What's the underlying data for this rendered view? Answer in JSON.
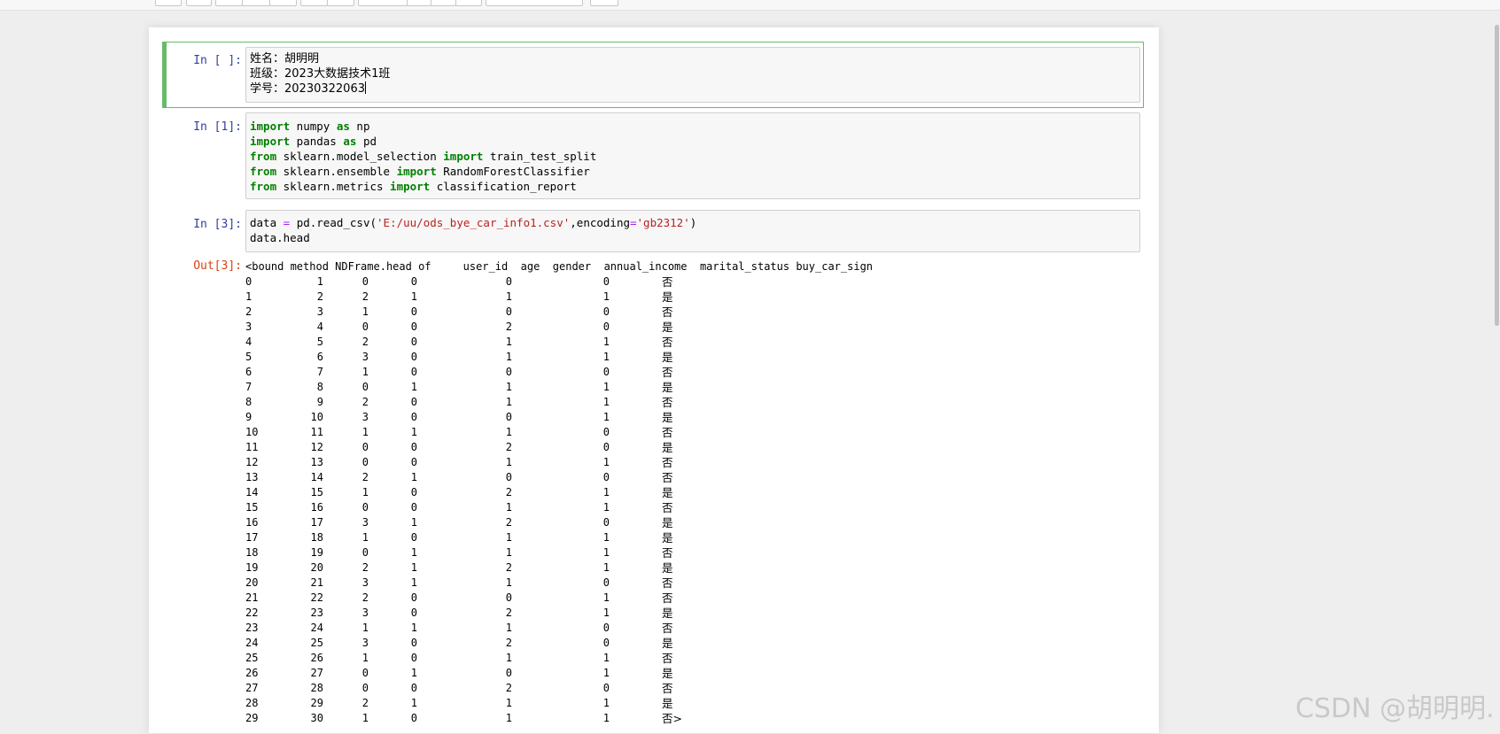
{
  "toolbar": {
    "buttons": [
      "",
      "",
      "",
      "",
      "",
      "",
      "",
      "",
      "",
      "",
      "",
      ""
    ]
  },
  "cells": {
    "markdown": {
      "prompt": "In [ ]:",
      "lines": [
        "姓名：胡明明",
        "班级：2023大数据技术1班",
        "学号：20230322063"
      ]
    },
    "imports": {
      "prompt": "In [1]:",
      "lines": [
        {
          "kw1": "import",
          "mid": " numpy ",
          "kw2": "as",
          "end": " np"
        },
        {
          "kw1": "import",
          "mid": " pandas ",
          "kw2": "as",
          "end": " pd"
        },
        {
          "kw1": "from",
          "mid": " sklearn.model_selection ",
          "kw2": "import",
          "end": " train_test_split"
        },
        {
          "kw1": "from",
          "mid": " sklearn.ensemble ",
          "kw2": "import",
          "end": " RandomForestClassifier"
        },
        {
          "kw1": "from",
          "mid": " sklearn.metrics ",
          "kw2": "import",
          "end": " classification_report"
        }
      ]
    },
    "read": {
      "prompt": "In [3]:",
      "line1_a": "data ",
      "line1_op": "=",
      "line1_b": " pd.read_csv(",
      "line1_s1": "'E:/uu/ods_bye_car_info1.csv'",
      "line1_c": ",encoding",
      "line1_op2": "=",
      "line1_s2": "'gb2312'",
      "line1_d": ")",
      "line2": "data.head"
    },
    "output": {
      "prompt": "Out[3]:",
      "header": "<bound method NDFrame.head of     user_id  age  gender  annual_income  marital_status buy_car_sign",
      "rows": [
        [
          "0",
          "1",
          "0",
          "0",
          "0",
          "0",
          "否"
        ],
        [
          "1",
          "2",
          "2",
          "1",
          "1",
          "1",
          "是"
        ],
        [
          "2",
          "3",
          "1",
          "0",
          "0",
          "0",
          "否"
        ],
        [
          "3",
          "4",
          "0",
          "0",
          "2",
          "0",
          "是"
        ],
        [
          "4",
          "5",
          "2",
          "0",
          "1",
          "1",
          "否"
        ],
        [
          "5",
          "6",
          "3",
          "0",
          "1",
          "1",
          "是"
        ],
        [
          "6",
          "7",
          "1",
          "0",
          "0",
          "0",
          "否"
        ],
        [
          "7",
          "8",
          "0",
          "1",
          "1",
          "1",
          "是"
        ],
        [
          "8",
          "9",
          "2",
          "0",
          "1",
          "1",
          "否"
        ],
        [
          "9",
          "10",
          "3",
          "0",
          "0",
          "1",
          "是"
        ],
        [
          "10",
          "11",
          "1",
          "1",
          "1",
          "0",
          "否"
        ],
        [
          "11",
          "12",
          "0",
          "0",
          "2",
          "0",
          "是"
        ],
        [
          "12",
          "13",
          "0",
          "0",
          "1",
          "1",
          "否"
        ],
        [
          "13",
          "14",
          "2",
          "1",
          "0",
          "0",
          "否"
        ],
        [
          "14",
          "15",
          "1",
          "0",
          "2",
          "1",
          "是"
        ],
        [
          "15",
          "16",
          "0",
          "0",
          "1",
          "1",
          "否"
        ],
        [
          "16",
          "17",
          "3",
          "1",
          "2",
          "0",
          "是"
        ],
        [
          "17",
          "18",
          "1",
          "0",
          "1",
          "1",
          "是"
        ],
        [
          "18",
          "19",
          "0",
          "1",
          "1",
          "1",
          "否"
        ],
        [
          "19",
          "20",
          "2",
          "1",
          "2",
          "1",
          "是"
        ],
        [
          "20",
          "21",
          "3",
          "1",
          "1",
          "0",
          "否"
        ],
        [
          "21",
          "22",
          "2",
          "0",
          "0",
          "1",
          "否"
        ],
        [
          "22",
          "23",
          "3",
          "0",
          "2",
          "1",
          "是"
        ],
        [
          "23",
          "24",
          "1",
          "1",
          "1",
          "0",
          "否"
        ],
        [
          "24",
          "25",
          "3",
          "0",
          "2",
          "0",
          "是"
        ],
        [
          "25",
          "26",
          "1",
          "0",
          "1",
          "1",
          "否"
        ],
        [
          "26",
          "27",
          "0",
          "1",
          "0",
          "1",
          "是"
        ],
        [
          "27",
          "28",
          "0",
          "0",
          "2",
          "0",
          "否"
        ],
        [
          "28",
          "29",
          "2",
          "1",
          "1",
          "1",
          "是"
        ],
        [
          "29",
          "30",
          "1",
          "0",
          "1",
          "1",
          "否>"
        ]
      ]
    }
  },
  "watermark": "CSDN @胡明明."
}
